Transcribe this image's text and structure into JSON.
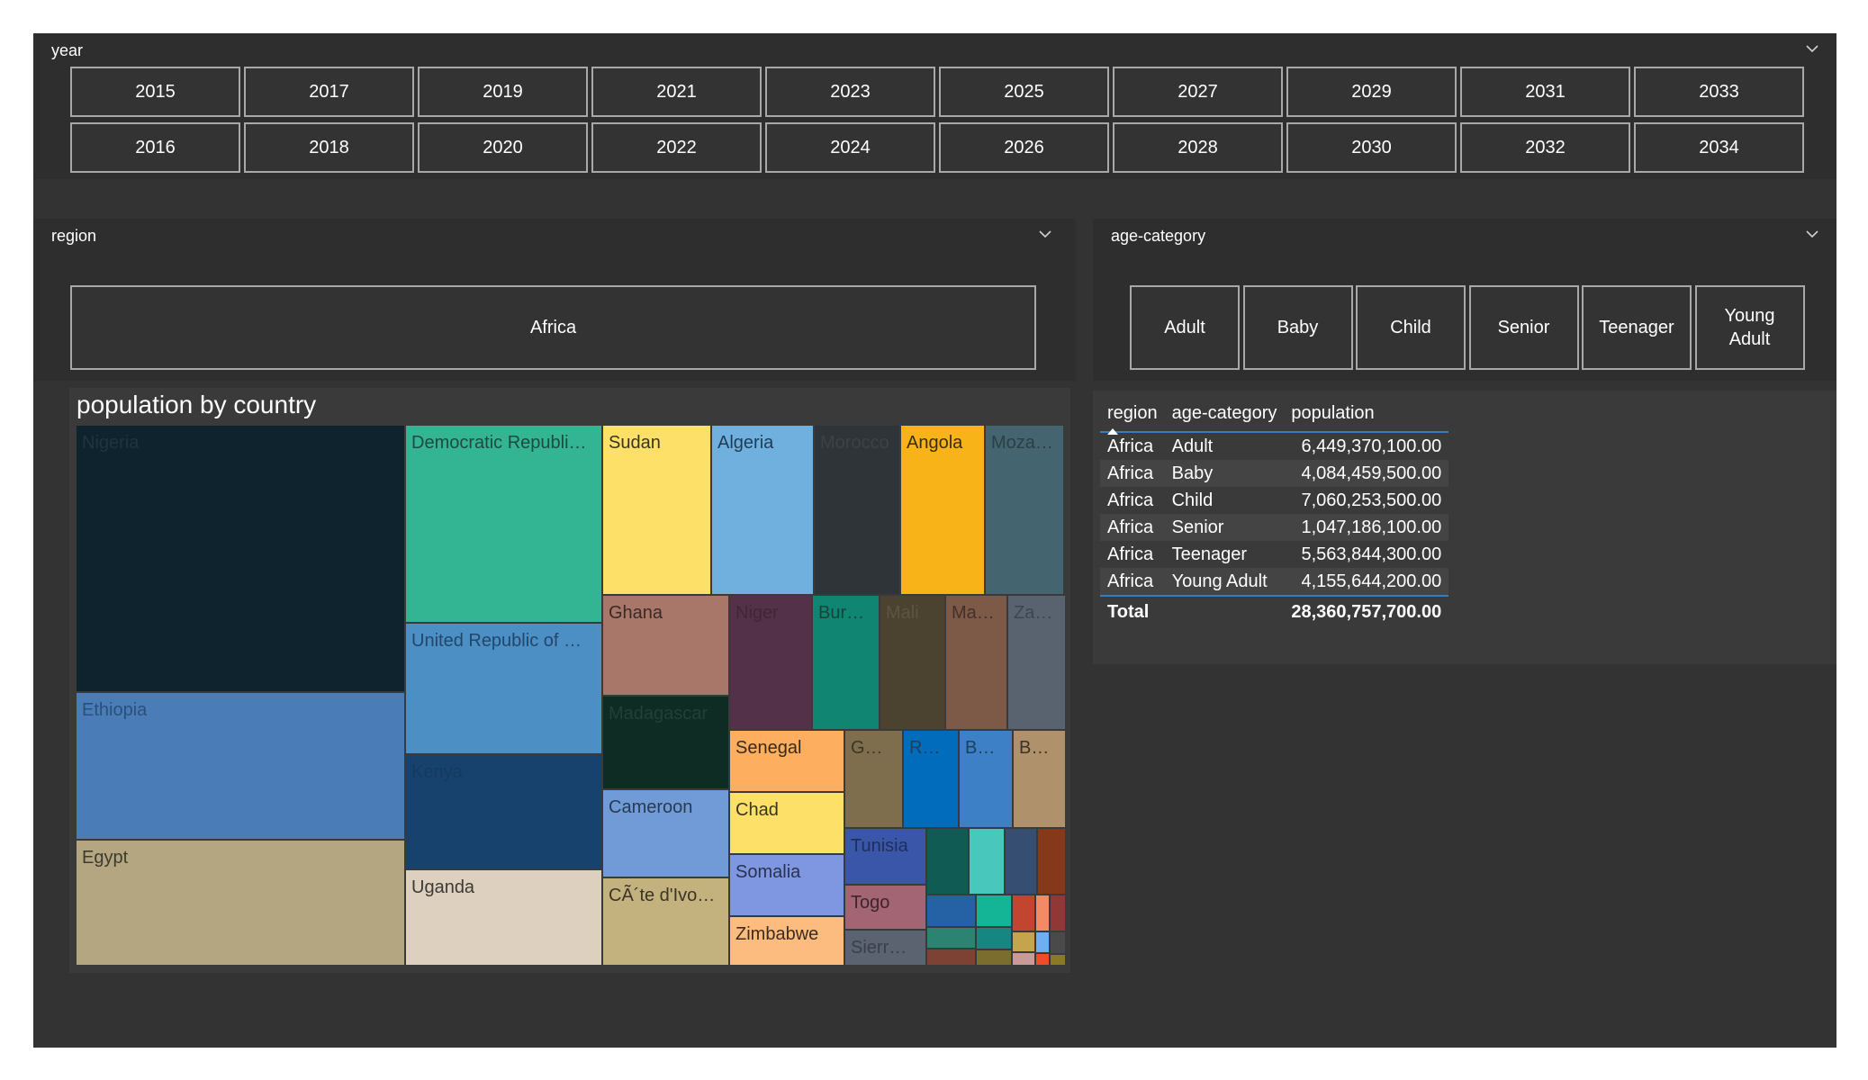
{
  "year_slicer": {
    "title": "year",
    "row1": [
      "2015",
      "2017",
      "2019",
      "2021",
      "2023",
      "2025",
      "2027",
      "2029",
      "2031",
      "2033"
    ],
    "row2": [
      "2016",
      "2018",
      "2020",
      "2022",
      "2024",
      "2026",
      "2028",
      "2030",
      "2032",
      "2034"
    ]
  },
  "region_slicer": {
    "title": "region",
    "items": [
      "Africa"
    ]
  },
  "age_slicer": {
    "title": "age-category",
    "items": [
      "Adult",
      "Baby",
      "Child",
      "Senior",
      "Teenager",
      "Young Adult"
    ]
  },
  "table": {
    "headers": [
      "region",
      "age-category",
      "population"
    ],
    "rows": [
      [
        "Africa",
        "Adult",
        "6,449,370,100.00"
      ],
      [
        "Africa",
        "Baby",
        "4,084,459,500.00"
      ],
      [
        "Africa",
        "Child",
        "7,060,253,500.00"
      ],
      [
        "Africa",
        "Senior",
        "1,047,186,100.00"
      ],
      [
        "Africa",
        "Teenager",
        "5,563,844,300.00"
      ],
      [
        "Africa",
        "Young Adult",
        "4,155,644,200.00"
      ]
    ],
    "total_label": "Total",
    "total_value": "28,360,757,700.00"
  },
  "chart_data": {
    "type": "treemap",
    "title": "population by country",
    "leaves": [
      {
        "label": "Nigeria",
        "color": "#0e232d",
        "text": "#1e3540"
      },
      {
        "label": "Ethiopia",
        "color": "#4a7db7",
        "text": "#2b4f78"
      },
      {
        "label": "Egypt",
        "color": "#b4a681",
        "text": "#3b3b30"
      },
      {
        "label": "Democratic Republi…",
        "color": "#33b594",
        "text": "#1f4a40"
      },
      {
        "label": "United Republic of …",
        "color": "#4b8fc5",
        "text": "#23476a"
      },
      {
        "label": "Kenya",
        "color": "#16426d",
        "text": "#143a60"
      },
      {
        "label": "Uganda",
        "color": "#ded0bf",
        "text": "#3c3a36"
      },
      {
        "label": "Sudan",
        "color": "#fde068",
        "text": "#3a3520"
      },
      {
        "label": "Algeria",
        "color": "#6fb0de",
        "text": "#1f3c55"
      },
      {
        "label": "Morocco",
        "color": "#2e3438",
        "text": "#3c4246"
      },
      {
        "label": "Angola",
        "color": "#f8b318",
        "text": "#3a2d0c"
      },
      {
        "label": "Moza…",
        "color": "#44646f",
        "text": "#2a3f46"
      },
      {
        "label": "Ghana",
        "color": "#a8776a",
        "text": "#3a2a25"
      },
      {
        "label": "Madagascar",
        "color": "#0e2b24",
        "text": "#243f36"
      },
      {
        "label": "Cameroon",
        "color": "#709bd6",
        "text": "#283a55"
      },
      {
        "label": "CÃ´te d'Ivo…",
        "color": "#c3b27e",
        "text": "#3a3526"
      },
      {
        "label": "Niger",
        "color": "#533148",
        "text": "#3f2737"
      },
      {
        "label": "Bur…",
        "color": "#0f8572",
        "text": "#1d4038"
      },
      {
        "label": "Mali",
        "color": "#4c4230",
        "text": "#5e5440"
      },
      {
        "label": "Ma…",
        "color": "#7d5948",
        "text": "#42312a"
      },
      {
        "label": "Za…",
        "color": "#596370",
        "text": "#3d4550"
      },
      {
        "label": "Senegal",
        "color": "#fdae5e",
        "text": "#3a2a18"
      },
      {
        "label": "Chad",
        "color": "#fde067",
        "text": "#3a3520"
      },
      {
        "label": "Somalia",
        "color": "#7f97e0",
        "text": "#29324f"
      },
      {
        "label": "Zimbabwe",
        "color": "#fdbc7f",
        "text": "#3b2d20"
      },
      {
        "label": "G…",
        "color": "#7e6e4d",
        "text": "#3d3526"
      },
      {
        "label": "R…",
        "color": "#006cbb",
        "text": "#1e3e5c"
      },
      {
        "label": "B…",
        "color": "#3d80c5",
        "text": "#1f3f60"
      },
      {
        "label": "B…",
        "color": "#af926c",
        "text": "#3d3326"
      },
      {
        "label": "Tunisia",
        "color": "#3a56a9",
        "text": "#1f2f5c"
      },
      {
        "label": "Togo",
        "color": "#a36474",
        "text": "#3c252b"
      },
      {
        "label": "Sierr…",
        "color": "#5b6270",
        "text": "#3a404a"
      },
      {
        "label": "",
        "color": "#105c55",
        "text": "#000"
      },
      {
        "label": "",
        "color": "#48c8bd",
        "text": "#000"
      },
      {
        "label": "",
        "color": "#354e72",
        "text": "#000"
      },
      {
        "label": "",
        "color": "#86391a",
        "text": "#000"
      },
      {
        "label": "",
        "color": "#2461a5",
        "text": "#000"
      },
      {
        "label": "",
        "color": "#14b596",
        "text": "#000"
      },
      {
        "label": "",
        "color": "#c2452f",
        "text": "#000"
      },
      {
        "label": "",
        "color": "#f28b63",
        "text": "#000"
      },
      {
        "label": "",
        "color": "#923738",
        "text": "#000"
      },
      {
        "label": "",
        "color": "#2d8372",
        "text": "#000"
      },
      {
        "label": "",
        "color": "#168680",
        "text": "#000"
      },
      {
        "label": "",
        "color": "#c4a44d",
        "text": "#000"
      },
      {
        "label": "",
        "color": "#6faef0",
        "text": "#000"
      },
      {
        "label": "",
        "color": "#4a4a4a",
        "text": "#000"
      },
      {
        "label": "",
        "color": "#7d4233",
        "text": "#000"
      },
      {
        "label": "",
        "color": "#7a6d2d",
        "text": "#000"
      },
      {
        "label": "",
        "color": "#c99b98",
        "text": "#000"
      },
      {
        "label": "",
        "color": "#f04c2a",
        "text": "#000"
      },
      {
        "label": "",
        "color": "#8b7a24",
        "text": "#000"
      }
    ]
  }
}
